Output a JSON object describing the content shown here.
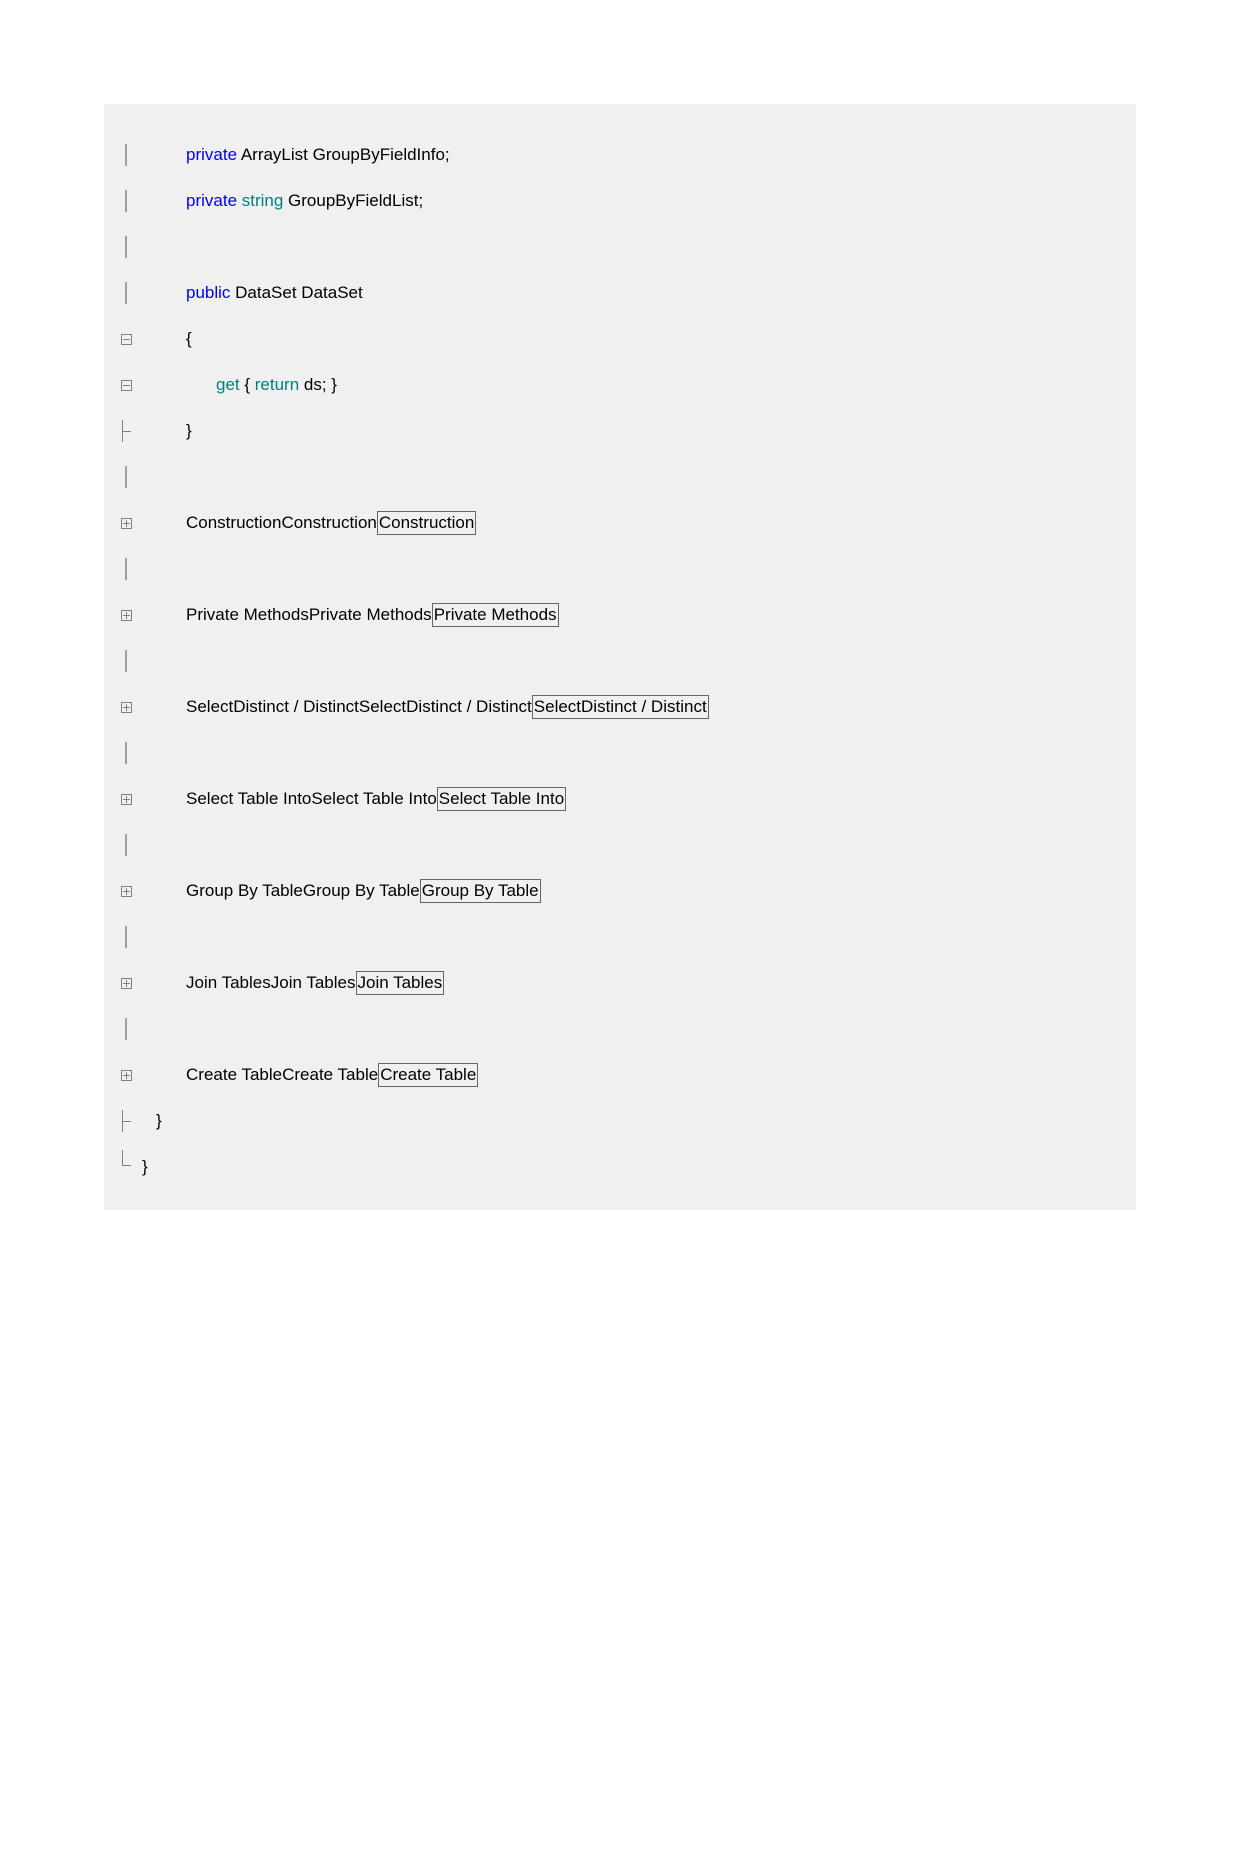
{
  "lines": {
    "l1": {
      "kw": "private",
      "rest": " ArrayList GroupByFieldInfo;"
    },
    "l2": {
      "kw": "private ",
      "type": "string",
      "rest": " GroupByFieldList;"
    },
    "l3": {
      "kw": "public",
      "rest": " DataSet DataSet"
    },
    "l4": {
      "brace": "{"
    },
    "l5": {
      "kw1": "get",
      "mid": " { ",
      "kw2": "return",
      "rest": " ds; }"
    },
    "l6": {
      "brace": "}"
    },
    "r1": {
      "t": "Construction"
    },
    "r2": {
      "t": "Private Methods"
    },
    "r3": {
      "t": "SelectDistinct / Distinct"
    },
    "r4": {
      "t": "Select Table Into"
    },
    "r5": {
      "t": "Group By Table"
    },
    "r6": {
      "t": "Join Tables"
    },
    "r7": {
      "t": "Create Table"
    },
    "end1": {
      "brace": "}"
    },
    "end2": {
      "brace": "}"
    }
  }
}
